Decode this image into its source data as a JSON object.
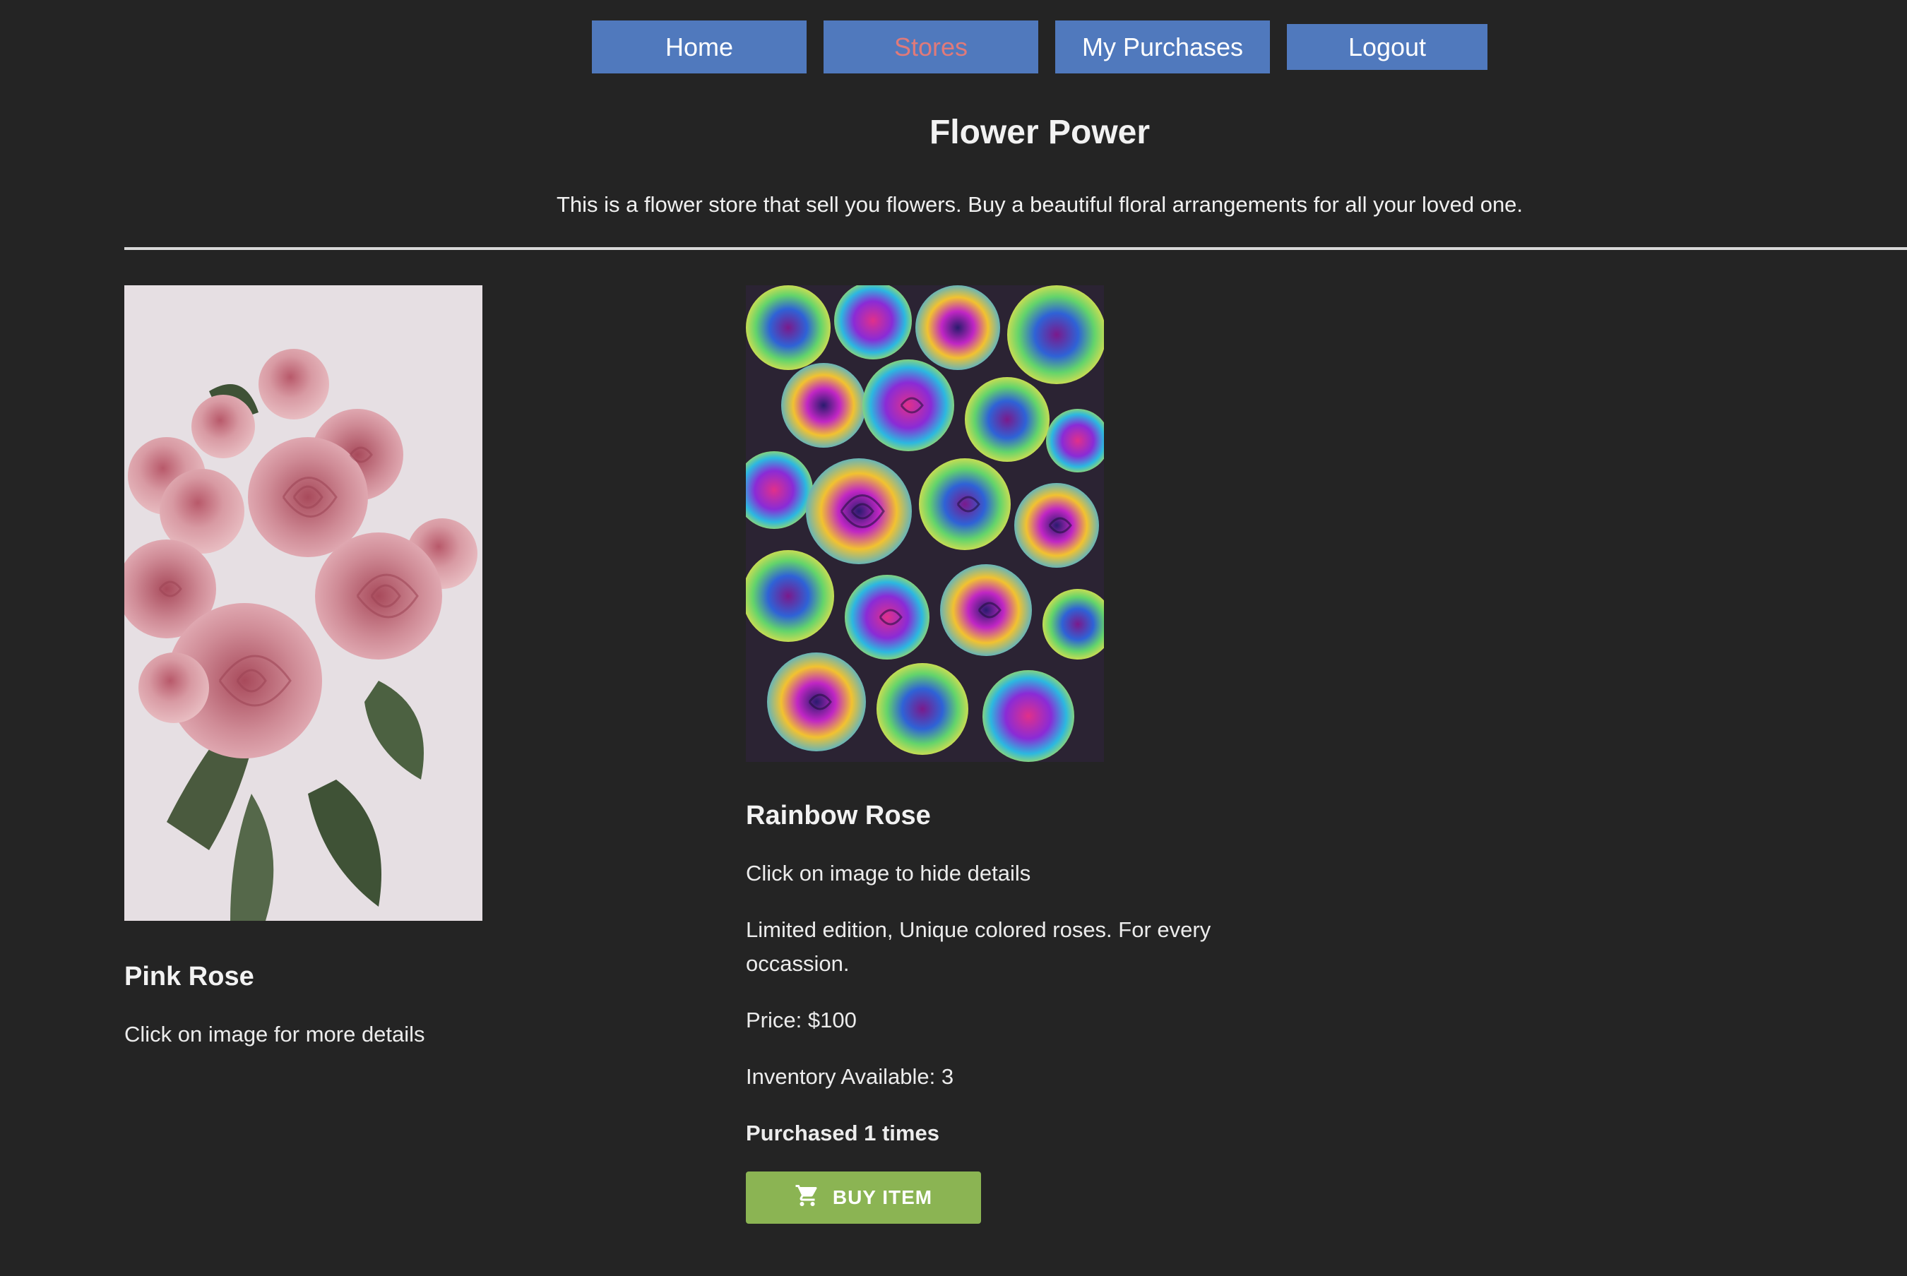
{
  "nav": {
    "home": "Home",
    "stores": "Stores",
    "purchases": "My Purchases",
    "logout": "Logout"
  },
  "store": {
    "title": "Flower Power",
    "description": "This is a flower store that sell you flowers. Buy a beautiful floral arrangements for all your loved one."
  },
  "products": [
    {
      "name": "Pink Rose",
      "hint": "Click on image for more details"
    },
    {
      "name": "Rainbow Rose",
      "hint": "Click on image to hide details",
      "description": "Limited edition, Unique colored roses. For every occassion.",
      "price": "Price: $100",
      "inventory": "Inventory Available: 3",
      "purchased": "Purchased 1 times",
      "buy_label": "BUY ITEM"
    }
  ],
  "icons": {
    "buy": "shopping-cart-icon"
  },
  "colors": {
    "background": "#242424",
    "nav_button": "#5079bd",
    "nav_active_text": "#e07a7a",
    "buy_button": "#8bb453"
  }
}
